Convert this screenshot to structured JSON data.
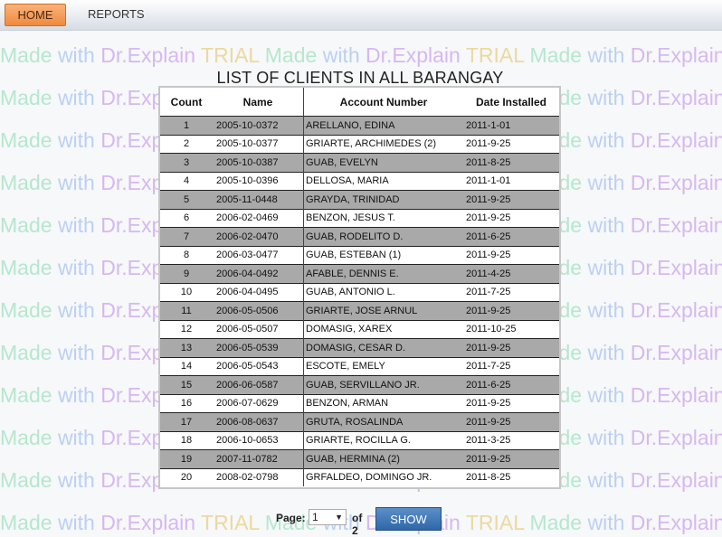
{
  "nav": {
    "home_label": "HOME",
    "reports_label": "REPORTS"
  },
  "page": {
    "title": "LIST OF CLIENTS IN ALL BARANGAY"
  },
  "watermark": {
    "made": "Made",
    "with": "with",
    "dr": "Dr.Explain",
    "trial": "TRIAL"
  },
  "table": {
    "headers": [
      "Count",
      "Name",
      "Account Number",
      "Date Installed"
    ],
    "rows": [
      [
        "1",
        "2005-10-0372",
        "ARELLANO, EDINA",
        "2011-1-01"
      ],
      [
        "2",
        "2005-10-0377",
        "GRIARTE, ARCHIMEDES (2)",
        "2011-9-25"
      ],
      [
        "3",
        "2005-10-0387",
        "GUAB, EVELYN",
        "2011-8-25"
      ],
      [
        "4",
        "2005-10-0396",
        "DELLOSA, MARIA",
        "2011-1-01"
      ],
      [
        "5",
        "2005-11-0448",
        "GRAYDA, TRINIDAD",
        "2011-9-25"
      ],
      [
        "6",
        "2006-02-0469",
        "BENZON, JESUS T.",
        "2011-9-25"
      ],
      [
        "7",
        "2006-02-0470",
        "GUAB, RODELITO D.",
        "2011-6-25"
      ],
      [
        "8",
        "2006-03-0477",
        "GUAB, ESTEBAN (1)",
        "2011-9-25"
      ],
      [
        "9",
        "2006-04-0492",
        "AFABLE, DENNIS E.",
        "2011-4-25"
      ],
      [
        "10",
        "2006-04-0495",
        "GUAB, ANTONIO L.",
        "2011-7-25"
      ],
      [
        "11",
        "2006-05-0506",
        "GRIARTE, JOSE ARNUL",
        "2011-9-25"
      ],
      [
        "12",
        "2006-05-0507",
        "DOMASIG, XAREX",
        "2011-10-25"
      ],
      [
        "13",
        "2006-05-0539",
        "DOMASIG, CESAR D.",
        "2011-9-25"
      ],
      [
        "14",
        "2006-05-0543",
        "ESCOTE, EMELY",
        "2011-7-25"
      ],
      [
        "15",
        "2006-06-0587",
        "GUAB, SERVILLANO JR.",
        "2011-6-25"
      ],
      [
        "16",
        "2006-07-0629",
        "BENZON, ARMAN",
        "2011-9-25"
      ],
      [
        "17",
        "2006-08-0637",
        "GRUTA, ROSALINDA",
        "2011-9-25"
      ],
      [
        "18",
        "2006-10-0653",
        "GRIARTE, ROCILLA G.",
        "2011-3-25"
      ],
      [
        "19",
        "2007-11-0782",
        "GUAB, HERMINA (2)",
        "2011-9-25"
      ],
      [
        "20",
        "2008-02-0798",
        "GRFALDEO, DOMINGO JR.",
        "2011-8-25"
      ]
    ]
  },
  "pager": {
    "label": "Page:",
    "selected_page": "1",
    "of_text": "of 2",
    "show_label": "SHOW"
  },
  "colors": {
    "home_accent": "#f08a3c",
    "show_button": "#3a72b3",
    "row_shade": "#a9a9a9"
  }
}
